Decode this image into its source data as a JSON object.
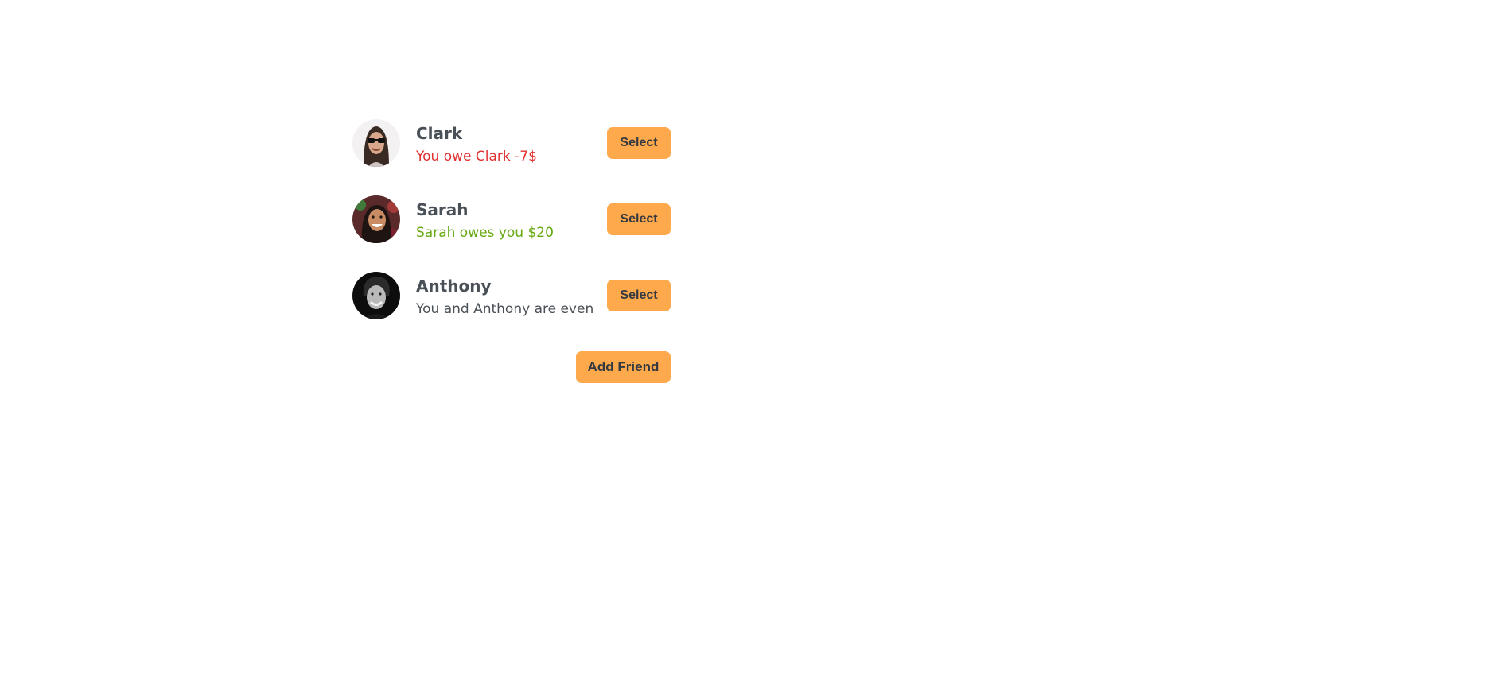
{
  "friends": [
    {
      "name": "Clark",
      "balance_text": "You owe Clark -7$",
      "balance_color": "#e03131",
      "select_label": "Select",
      "avatar": "avatar-clark"
    },
    {
      "name": "Sarah",
      "balance_text": "Sarah owes you $20",
      "balance_color": "#66a80f",
      "select_label": "Select",
      "avatar": "avatar-sarah"
    },
    {
      "name": "Anthony",
      "balance_text": "You and Anthony are even",
      "balance_color": "#495057",
      "select_label": "Select",
      "avatar": "avatar-anthony"
    }
  ],
  "add_friend_label": "Add Friend",
  "colors": {
    "button_bg": "#ffa94d",
    "button_text": "#343a40",
    "name_text": "#495057"
  }
}
